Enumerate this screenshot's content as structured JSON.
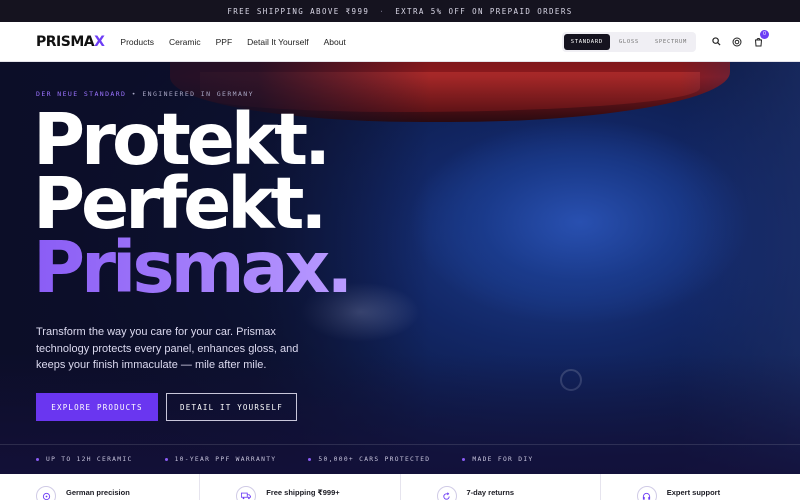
{
  "announcement": {
    "left": "FREE SHIPPING ABOVE ₹999",
    "separator": "·",
    "right": "EXTRA 5% OFF ON PREPAID ORDERS"
  },
  "nav": {
    "logo_main": "PRISMA",
    "logo_accent": "X",
    "links": [
      "Products",
      "Ceramic",
      "PPF",
      "Detail It Yourself",
      "About"
    ],
    "variants": [
      "STANDARD",
      "GLOSS",
      "SPECTRUM"
    ],
    "active_variant": "STANDARD",
    "cart_count": "0",
    "icons": [
      "search-icon",
      "globe-icon",
      "cart-icon"
    ]
  },
  "hero": {
    "eyebrow_a": "DER NEUE STANDARD",
    "eyebrow_sep": "•",
    "eyebrow_b": "ENGINEERED IN GERMANY",
    "headline": [
      "Protekt.",
      "Perfekt.",
      "Prismax."
    ],
    "lede": "Transform the way you care for your car. Prismax technology protects every panel, enhances gloss, and keeps your finish immaculate — mile after mile.",
    "primary_cta": "EXPLORE PRODUCTS",
    "secondary_cta": "DETAIL IT YOURSELF",
    "stats": [
      "UP TO 12H CERAMIC",
      "10-YEAR PPF WARRANTY",
      "50,000+ CARS PROTECTED",
      "MADE FOR DIY"
    ]
  },
  "features": [
    {
      "title": "German precision",
      "icon": "precision-icon"
    },
    {
      "title": "Free shipping ₹999+",
      "icon": "truck-icon"
    },
    {
      "title": "7-day returns",
      "icon": "return-icon"
    },
    {
      "title": "Expert support",
      "icon": "support-icon"
    }
  ],
  "colors": {
    "accent": "#6a36f0",
    "accent_light": "#b99bff",
    "dark": "#15131f"
  }
}
